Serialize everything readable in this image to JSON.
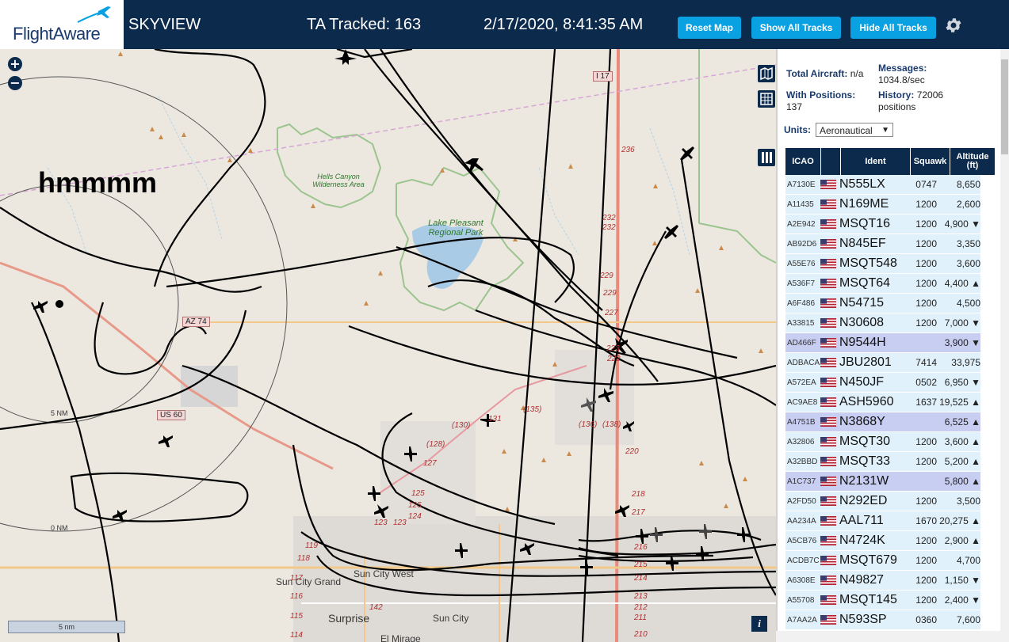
{
  "header": {
    "logo_text": "FlightAware",
    "app_title": "SKYVIEW",
    "ta_tracked": "TA Tracked: 163",
    "clock": "2/17/2020, 8:41:35 AM",
    "buttons": {
      "reset_map": "Reset Map",
      "show_all_tracks": "Show All Tracks",
      "hide_all_tracks": "Hide All Tracks"
    },
    "icons": {
      "settings": "gear-icon",
      "logo": "airplane-icon"
    },
    "colors": {
      "bar": "#0b2a4c",
      "button": "#0aa1e2"
    }
  },
  "map": {
    "zoom_in": "+",
    "zoom_out": "−",
    "annotation": "hmmmm",
    "labels": {
      "hells_canyon": "Hells Canyon Wilderness Area",
      "lake_pleasant": "Lake Pleasant Regional Park",
      "sun_city_west": "Sun City West",
      "sun_city_grand": "Sun City Grand",
      "surprise": "Surprise",
      "sun_city": "Sun City",
      "el_mirage": "El Mirage",
      "ring_5nm": "5 NM",
      "ring_0nm": "0 NM"
    },
    "shields": {
      "i17": "I 17",
      "az74": "AZ 74",
      "us60": "US 60"
    },
    "road_numbers": [
      "236",
      "232",
      "232",
      "229",
      "229",
      "227",
      "223",
      "222",
      "220",
      "218",
      "217",
      "216",
      "215",
      "214",
      "213",
      "212",
      "211",
      "210",
      "131",
      "(130)",
      "(128)",
      "127",
      "125",
      "125",
      "124",
      "123",
      "123",
      "119",
      "118",
      "117",
      "116",
      "115",
      "114",
      "142",
      "(135)",
      "(136)",
      "(138)"
    ],
    "scale": "5 nm",
    "info": "i",
    "controls": [
      "map-icon",
      "grid-icon",
      "columns-icon"
    ]
  },
  "sidebar": {
    "total_aircraft_label": "Total Aircraft:",
    "total_aircraft_value": "n/a",
    "messages_label": "Messages:",
    "messages_value": "1034.8/sec",
    "with_positions_label": "With Positions:",
    "with_positions_value": "137",
    "history_label": "History:",
    "history_value": "72006",
    "history_unit": "positions",
    "units_label": "Units:",
    "units_value": "Aeronautical",
    "table": {
      "headers": {
        "icao": "ICAO",
        "ident": "Ident",
        "squawk": "Squawk",
        "altitude": "Altitude (ft)"
      },
      "rows": [
        {
          "icao": "A7130E",
          "ident": "N555LX",
          "squawk": "0747",
          "alt": "8,650",
          "hl": false
        },
        {
          "icao": "A11435",
          "ident": "N169ME",
          "squawk": "1200",
          "alt": "2,600",
          "hl": false
        },
        {
          "icao": "A2E942",
          "ident": "MSQT16",
          "squawk": "1200",
          "alt": "4,900 ▼",
          "hl": false
        },
        {
          "icao": "AB92D6",
          "ident": "N845EF",
          "squawk": "1200",
          "alt": "3,350",
          "hl": false
        },
        {
          "icao": "A55E76",
          "ident": "MSQT548",
          "squawk": "1200",
          "alt": "3,600",
          "hl": false
        },
        {
          "icao": "A536F7",
          "ident": "MSQT64",
          "squawk": "1200",
          "alt": "4,400 ▲",
          "hl": false
        },
        {
          "icao": "A6F486",
          "ident": "N54715",
          "squawk": "1200",
          "alt": "4,500",
          "hl": false
        },
        {
          "icao": "A33815",
          "ident": "N30608",
          "squawk": "1200",
          "alt": "7,000 ▼",
          "hl": false
        },
        {
          "icao": "AD466F",
          "ident": "N9544H",
          "squawk": "",
          "alt": "3,900 ▼",
          "hl": true
        },
        {
          "icao": "ADBACA",
          "ident": "JBU2801",
          "squawk": "7414",
          "alt": "33,975",
          "hl": false
        },
        {
          "icao": "A572EA",
          "ident": "N450JF",
          "squawk": "0502",
          "alt": "6,950 ▼",
          "hl": false
        },
        {
          "icao": "AC9AE8",
          "ident": "ASH5960",
          "squawk": "1637",
          "alt": "19,525 ▲",
          "hl": false
        },
        {
          "icao": "A4751B",
          "ident": "N3868Y",
          "squawk": "",
          "alt": "6,525 ▲",
          "hl": true
        },
        {
          "icao": "A32806",
          "ident": "MSQT30",
          "squawk": "1200",
          "alt": "3,600 ▲",
          "hl": false
        },
        {
          "icao": "A32BBD",
          "ident": "MSQT33",
          "squawk": "1200",
          "alt": "5,200 ▲",
          "hl": false
        },
        {
          "icao": "A1C737",
          "ident": "N2131W",
          "squawk": "",
          "alt": "5,800 ▲",
          "hl": true
        },
        {
          "icao": "A2FD50",
          "ident": "N292ED",
          "squawk": "1200",
          "alt": "3,500",
          "hl": false
        },
        {
          "icao": "AA234A",
          "ident": "AAL711",
          "squawk": "1670",
          "alt": "20,275 ▲",
          "hl": false
        },
        {
          "icao": "A5CB76",
          "ident": "N4724K",
          "squawk": "1200",
          "alt": "2,900 ▲",
          "hl": false
        },
        {
          "icao": "ACDB7C",
          "ident": "MSQT679",
          "squawk": "1200",
          "alt": "4,700",
          "hl": false
        },
        {
          "icao": "A6308E",
          "ident": "N49827",
          "squawk": "1200",
          "alt": "1,150 ▼",
          "hl": false
        },
        {
          "icao": "A55708",
          "ident": "MSQT145",
          "squawk": "1200",
          "alt": "2,400 ▼",
          "hl": false
        },
        {
          "icao": "A7AA2A",
          "ident": "N593SP",
          "squawk": "0360",
          "alt": "7,600",
          "hl": false
        }
      ]
    }
  }
}
